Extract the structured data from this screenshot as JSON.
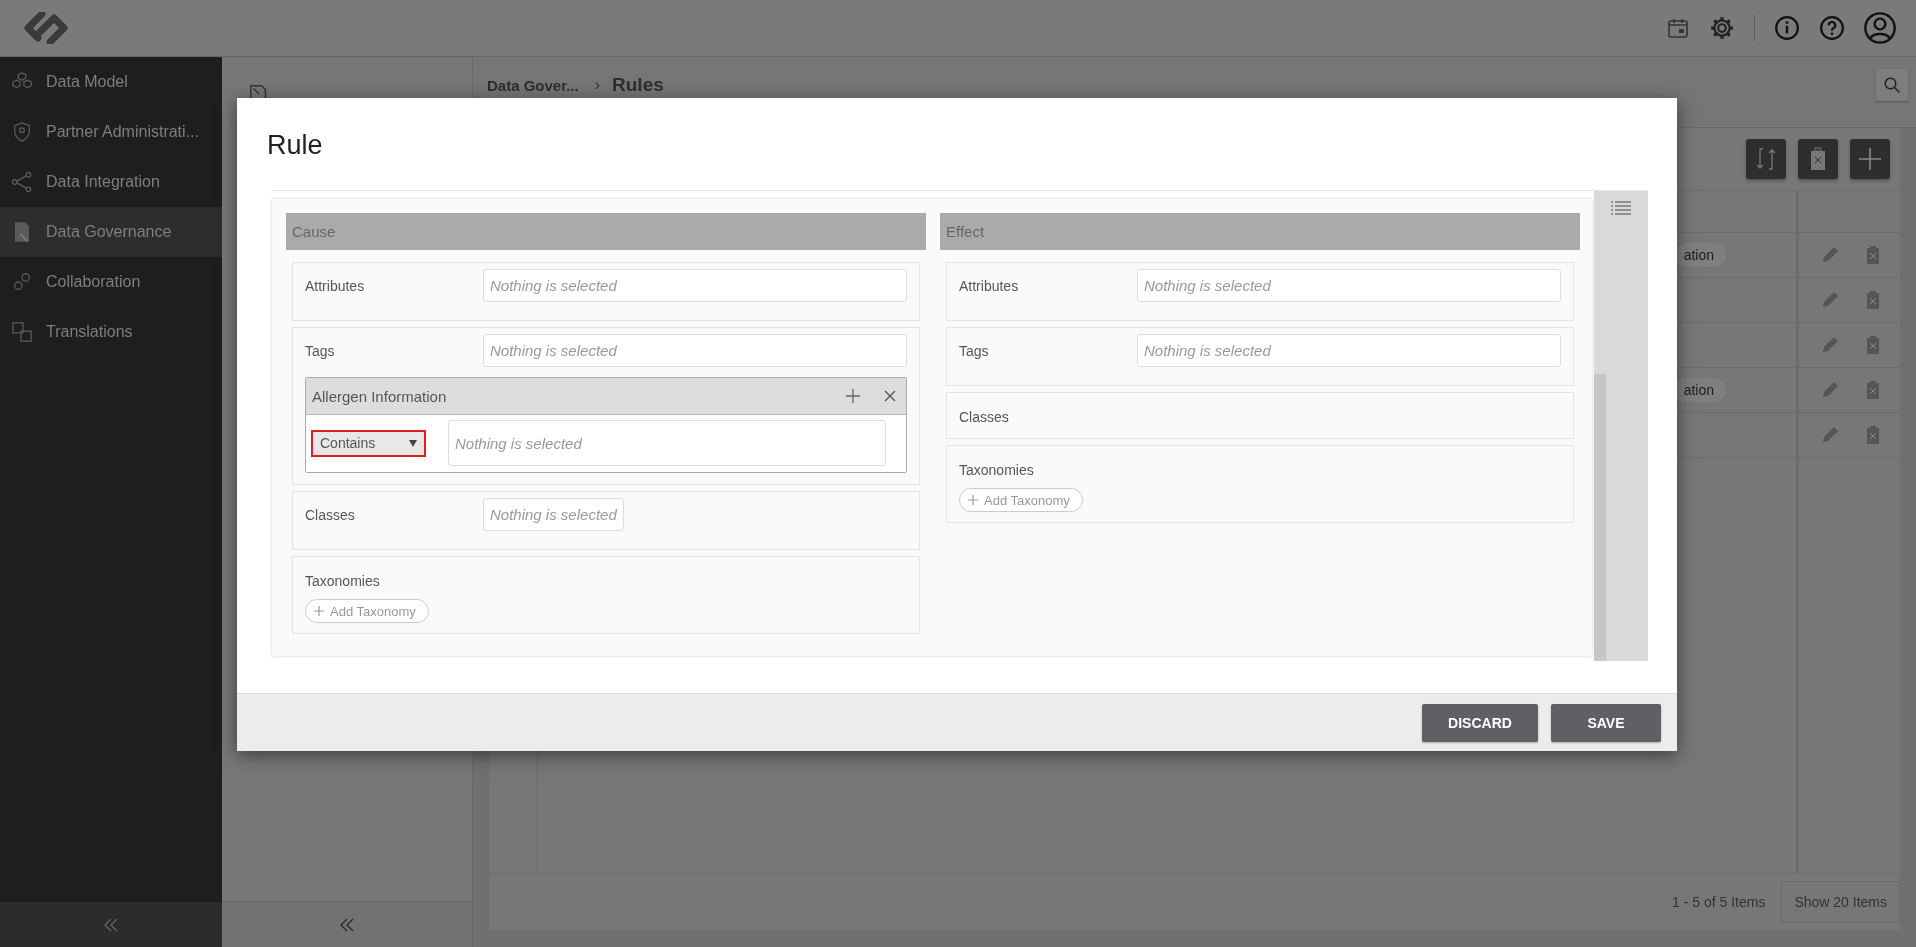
{
  "sidebar": {
    "items": [
      {
        "label": "Data Model",
        "selected": false
      },
      {
        "label": "Partner Administrati...",
        "selected": false
      },
      {
        "label": "Data Integration",
        "selected": false
      },
      {
        "label": "Data Governance",
        "selected": true
      },
      {
        "label": "Collaboration",
        "selected": false
      },
      {
        "label": "Translations",
        "selected": false
      }
    ]
  },
  "breadcrumb": {
    "parent": "Data Gover...",
    "separator": "›",
    "current": "Rules"
  },
  "table": {
    "rows": [
      {
        "kind": "tagged",
        "tag": "ation"
      },
      {
        "kind": "plain"
      },
      {
        "kind": "plain"
      },
      {
        "kind": "tagged",
        "tag": "ation"
      },
      {
        "kind": "plain"
      }
    ]
  },
  "pagination": {
    "summary": "1 - 5 of 5 Items",
    "page_size_button": "Show 20 Items"
  },
  "dialog": {
    "title": "Rule",
    "sections": [
      {
        "heading": "Cause",
        "fields": [
          {
            "kind": "select",
            "label": "Attributes",
            "placeholder": "Nothing is selected"
          },
          {
            "kind": "tags",
            "label": "Tags",
            "placeholder": "Nothing is selected",
            "groups": [
              {
                "title": "Allergen Information",
                "operator": "Contains",
                "highlighted": true,
                "placeholder": "Nothing is selected"
              }
            ]
          },
          {
            "kind": "small_select",
            "label": "Classes",
            "placeholder": "Nothing is selected"
          },
          {
            "kind": "taxonomies",
            "label": "Taxonomies",
            "button": "Add Taxonomy"
          }
        ]
      },
      {
        "heading": "Effect",
        "fields": [
          {
            "kind": "select",
            "label": "Attributes",
            "placeholder": "Nothing is selected"
          },
          {
            "kind": "select",
            "label": "Tags",
            "placeholder": "Nothing is selected"
          },
          {
            "kind": "label_only",
            "label": "Classes"
          },
          {
            "kind": "taxonomies",
            "label": "Taxonomies",
            "button": "Add Taxonomy"
          }
        ]
      }
    ],
    "buttons": [
      "DISCARD",
      "SAVE"
    ]
  }
}
